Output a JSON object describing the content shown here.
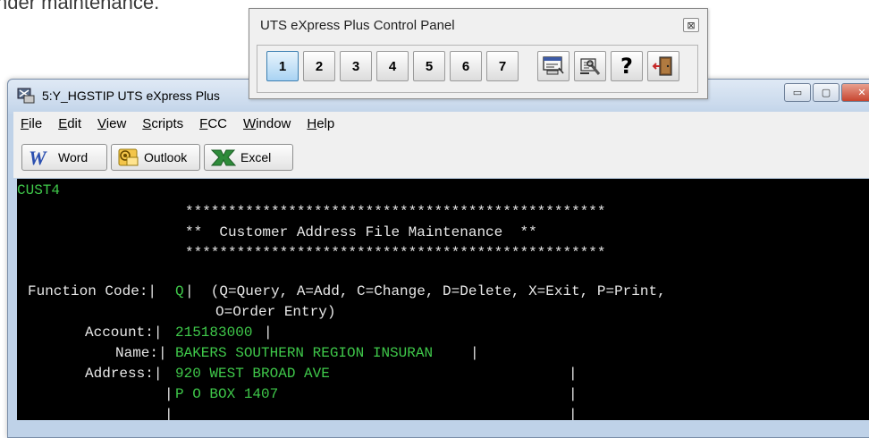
{
  "background": {
    "text": "nder maintenance."
  },
  "control_panel": {
    "title": "UTS eXpress Plus Control Panel",
    "close_glyph": "⊠",
    "session_buttons": [
      "1",
      "2",
      "3",
      "4",
      "5",
      "6",
      "7"
    ],
    "active_session": "1",
    "tool_icons": [
      "session-screen-icon",
      "settings-tools-icon",
      "help-icon",
      "exit-door-icon"
    ],
    "help_glyph": "?"
  },
  "window": {
    "title": "5:Y_HGSTIP UTS eXpress Plus",
    "controls": {
      "minimize": "▭",
      "maximize": "▢",
      "close": "✕"
    },
    "menu": [
      {
        "underline": "F",
        "rest": "ile"
      },
      {
        "underline": "E",
        "rest": "dit"
      },
      {
        "underline": "V",
        "rest": "iew"
      },
      {
        "underline": "S",
        "rest": "cripts"
      },
      {
        "underline": "F",
        "rest": "CC"
      },
      {
        "underline": "W",
        "rest": "indow"
      },
      {
        "underline": "H",
        "rest": "elp"
      }
    ],
    "toolbar": {
      "word": "Word",
      "outlook": "Outlook",
      "excel": "Excel"
    }
  },
  "terminal": {
    "screen_id": "CUST4",
    "banner_stars": "*************************************************",
    "banner_title": "**  Customer Address File Maintenance  **",
    "function_label": "Function Code:|",
    "function_value": "Q",
    "function_help_1": "|  (Q=Query, A=Add, C=Change, D=Delete, X=Exit, P=Print,",
    "function_help_2": "O=Order Entry)",
    "account_label": "Account:|",
    "account_value": "215183000",
    "account_end": "|",
    "name_label": "Name:|",
    "name_value": "BAKERS SOUTHERN REGION INSURAN",
    "name_end": "|",
    "address_label": "Address:|",
    "address_line1": "920 WEST BROAD AVE",
    "address_line2": "P O BOX 1407",
    "address_end": "|",
    "address_line3": ""
  },
  "colors": {
    "terminal_text_green": "#3fc84a",
    "terminal_text_white": "#e8e8e8",
    "terminal_background": "#000000",
    "active_button": "#a9d3f3"
  }
}
